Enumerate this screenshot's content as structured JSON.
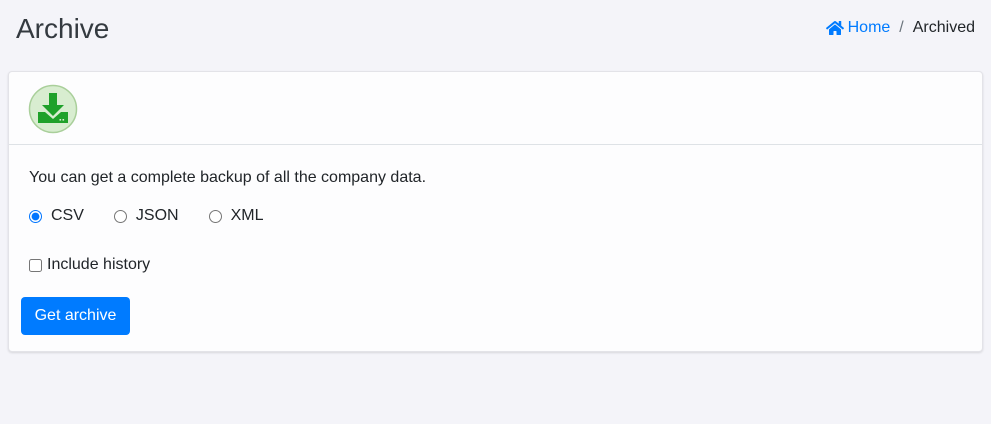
{
  "page": {
    "title": "Archive"
  },
  "breadcrumb": {
    "home_label": "Home",
    "separator": "/",
    "current_label": "Archived",
    "home_icon": "home-icon"
  },
  "card": {
    "icon": "download-icon",
    "intro": "You can get a complete backup of all the company data.",
    "formats": [
      {
        "label": "CSV",
        "checked": true
      },
      {
        "label": "JSON",
        "checked": false
      },
      {
        "label": "XML",
        "checked": false
      }
    ],
    "include_history_label": "Include history",
    "include_history_checked": false,
    "submit_label": "Get archive"
  },
  "colors": {
    "accent": "#007bff",
    "icon_green": "#1fa12a",
    "icon_bg": "#d8edd0"
  }
}
